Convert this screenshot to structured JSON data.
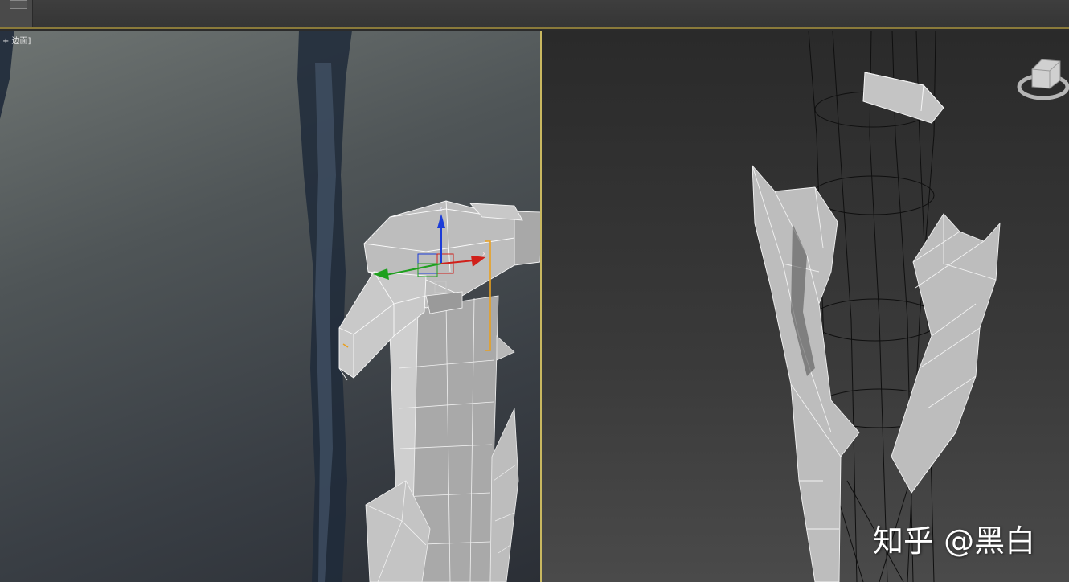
{
  "toolbar": {
    "active_tool_icon": "select-region-icon"
  },
  "viewport_left": {
    "label": "+ 边面]"
  },
  "viewport_right": {
    "navigation_icon": "viewcube-icon"
  },
  "colors": {
    "divider": "#c9b860",
    "gizmo_x": "#d0201a",
    "gizmo_y": "#1ea01e",
    "gizmo_z": "#1c3cd8",
    "selection": "#e8a020"
  },
  "watermark": {
    "text": "知乎 @黑白"
  }
}
